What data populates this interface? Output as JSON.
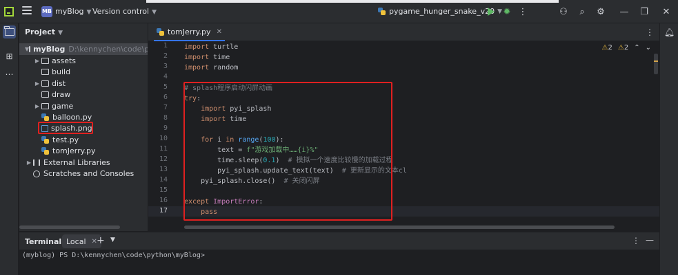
{
  "titlebar": {
    "project_badge": "MB",
    "project_name": "myBlog",
    "vcs": "Version control",
    "run_config": "pygame_hunger_snake_v20"
  },
  "project_panel": {
    "title": "Project",
    "root": {
      "name": "myBlog",
      "path": "D:\\kennychen\\code\\pytho"
    },
    "items": [
      {
        "label": "assets",
        "kind": "folder",
        "expandable": true
      },
      {
        "label": "build",
        "kind": "folder",
        "expandable": false
      },
      {
        "label": "dist",
        "kind": "folder",
        "expandable": true
      },
      {
        "label": "draw",
        "kind": "folder",
        "expandable": false
      },
      {
        "label": "game",
        "kind": "folder",
        "expandable": true
      },
      {
        "label": "balloon.py",
        "kind": "python",
        "expandable": false
      },
      {
        "label": "splash.png",
        "kind": "image",
        "expandable": false
      },
      {
        "label": "test.py",
        "kind": "python",
        "expandable": false
      },
      {
        "label": "tomJerry.py",
        "kind": "python",
        "expandable": false
      },
      {
        "label": "External Libraries",
        "kind": "library",
        "expandable": true
      },
      {
        "label": "Scratches and Consoles",
        "kind": "scratch",
        "expandable": false
      }
    ]
  },
  "editor": {
    "tab": "tomJerry.py",
    "warnings_a": "2",
    "warnings_b": "2",
    "current_line": 17,
    "lines": [
      "import turtle",
      "import time",
      "import random",
      "",
      "# splash程序启动闪屏动画",
      "try:",
      "    import pyi_splash",
      "    import time",
      "",
      "    for i in range(100):",
      "        text = f\"游戏加载中……{i}%\"",
      "        time.sleep(0.1)  # 模拟一个速度比较慢的加载过程",
      "        pyi_splash.update_text(text)  # 更新显示的文本cl",
      "    pyi_splash.close()  # 关闭闪屏",
      "",
      "except ImportError:",
      "    pass"
    ]
  },
  "terminal": {
    "title": "Terminal",
    "tab": "Local",
    "prompt": "(myblog) PS D:\\kennychen\\code\\python\\myBlog>"
  },
  "colors": {
    "accent": "#3574f0",
    "highlight_box": "#e02020",
    "keyword": "#cf8e6d",
    "string": "#6aab73",
    "number": "#2aacb8",
    "comment": "#7a7e85"
  }
}
